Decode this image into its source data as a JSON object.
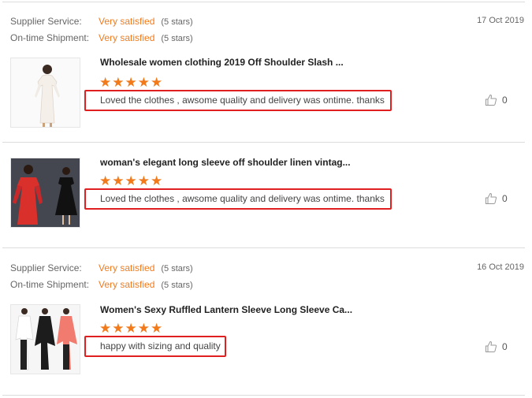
{
  "reviews": [
    {
      "supplier_label": "Supplier Service:",
      "supplier_value": "Very satisfied",
      "supplier_stars": "(5 stars)",
      "shipment_label": "On-time Shipment:",
      "shipment_value": "Very satisfied",
      "shipment_stars": "(5 stars)",
      "date": "17 Oct 2019",
      "title": "Wholesale women clothing 2019 Off Shoulder Slash ...",
      "rating": 5,
      "text": "Loved the clothes , awsome quality and delivery was ontime. thanks",
      "likes": "0"
    },
    {
      "title": "woman's elegant long sleeve off shoulder linen vintag...",
      "rating": 5,
      "text": "Loved the clothes , awsome quality and delivery was ontime. thanks",
      "likes": "0"
    },
    {
      "supplier_label": "Supplier Service:",
      "supplier_value": "Very satisfied",
      "supplier_stars": "(5 stars)",
      "shipment_label": "On-time Shipment:",
      "shipment_value": "Very satisfied",
      "shipment_stars": "(5 stars)",
      "date": "16 Oct 2019",
      "title": "Women's Sexy Ruffled Lantern Sleeve Long Sleeve Ca...",
      "rating": 5,
      "text": "happy with sizing and quality",
      "likes": "0"
    }
  ],
  "icons": {
    "star": "star-icon",
    "like": "thumbs-up-icon"
  },
  "colors": {
    "accent": "#f27a1a",
    "highlight_border": "#e02020"
  }
}
